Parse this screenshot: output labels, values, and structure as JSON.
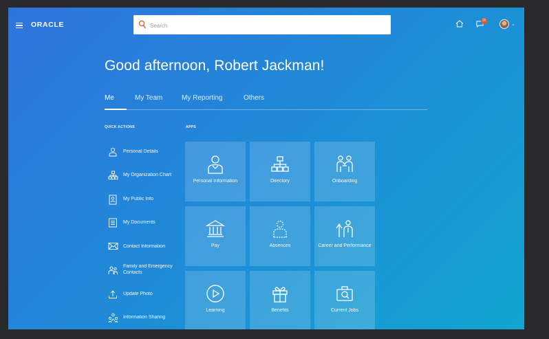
{
  "header": {
    "logo": "ORACLE",
    "search_placeholder": "Search",
    "notification_count": "15"
  },
  "greeting": "Good afternoon, Robert Jackman!",
  "tabs": [
    {
      "label": "Me",
      "active": true
    },
    {
      "label": "My Team",
      "active": false
    },
    {
      "label": "My Reporting",
      "active": false
    },
    {
      "label": "Others",
      "active": false
    }
  ],
  "quick_actions": {
    "heading": "QUICK ACTIONS",
    "items": [
      {
        "label": "Personal Details",
        "icon": "person-icon"
      },
      {
        "label": "My Organization Chart",
        "icon": "org-chart-icon"
      },
      {
        "label": "My Public Info",
        "icon": "id-card-icon"
      },
      {
        "label": "My Documents",
        "icon": "documents-icon"
      },
      {
        "label": "Contact Information",
        "icon": "envelope-icon"
      },
      {
        "label": "Family and Emergency Contacts",
        "icon": "family-icon"
      },
      {
        "label": "Update Photo",
        "icon": "upload-photo-icon"
      },
      {
        "label": "Information Sharing",
        "icon": "sharing-icon"
      }
    ]
  },
  "apps": {
    "heading": "APPS",
    "tiles": [
      {
        "label": "Personal Information",
        "icon": "person-icon"
      },
      {
        "label": "Directory",
        "icon": "directory-icon"
      },
      {
        "label": "Onboarding",
        "icon": "onboarding-icon"
      },
      {
        "label": "Pay",
        "icon": "bank-icon"
      },
      {
        "label": "Absences",
        "icon": "absence-icon"
      },
      {
        "label": "Career and Performance",
        "icon": "career-icon"
      },
      {
        "label": "Learning",
        "icon": "play-icon"
      },
      {
        "label": "Benefits",
        "icon": "gift-icon"
      },
      {
        "label": "Current Jobs",
        "icon": "briefcase-search-icon"
      }
    ]
  }
}
